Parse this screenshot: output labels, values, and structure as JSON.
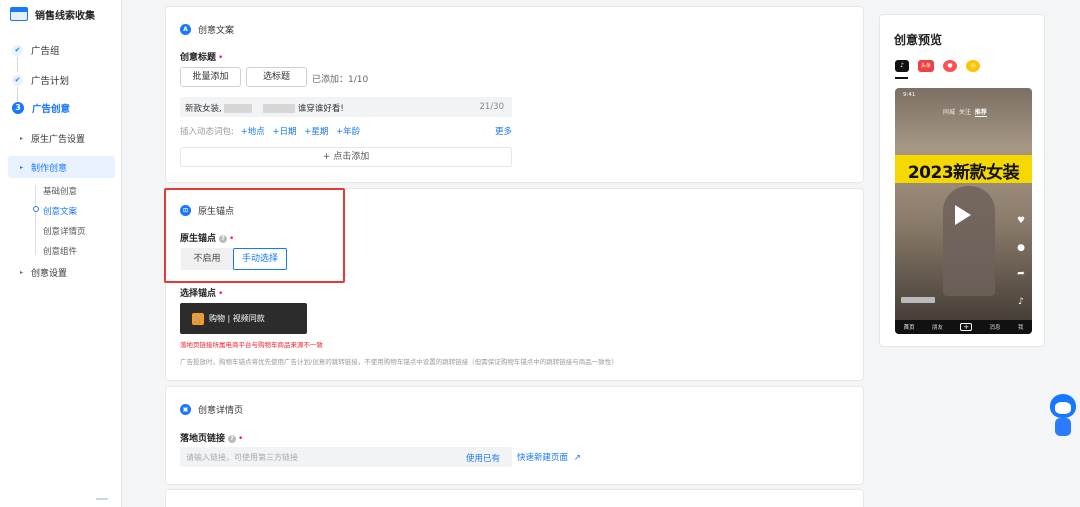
{
  "brand": {
    "title": "销售线索收集"
  },
  "nav": {
    "steps": [
      {
        "label": "广告组",
        "state": "done"
      },
      {
        "label": "广告计划",
        "state": "done"
      },
      {
        "label": "广告创意",
        "state": "active",
        "num": "3"
      }
    ],
    "sub_items": [
      {
        "label": "原生广告设置"
      },
      {
        "label": "制作创意"
      },
      {
        "label": "创意设置"
      }
    ],
    "leaves": [
      "基础创意",
      "创意文案",
      "创意详情页",
      "创意组件"
    ]
  },
  "copy_section": {
    "heading": "创意文案",
    "title_label": "创意标题",
    "batch_add": "批量添加",
    "pick_title": "选标题",
    "added_count": "已添加：1/10",
    "title_prefix": "新款女装,",
    "title_suffix": "谁穿谁好看!",
    "char_count": "21/30",
    "insert_label": "插入动态词包:",
    "words": [
      "+地点",
      "+日期",
      "+星期",
      "+年龄"
    ],
    "more": "更多",
    "click_add": "+ 点击添加"
  },
  "anchor_section": {
    "heading": "原生锚点",
    "anchor_label": "原生锚点",
    "options": [
      "不启用",
      "手动选择"
    ],
    "select_label": "选择锚点",
    "anchor_item": "购物 | 视频同款",
    "warning": "落地页链接所属电商平台与购物车商品来源不一致",
    "note": "广告投放时，购物车锚点将优先使用广告计划/创意的跳转链接，不使用购物车锚点中设置的跳转链接（但需保证购物车锚点中的跳转链接与商品一致性）"
  },
  "detail_section": {
    "heading": "创意详情页",
    "landing_label": "落地页链接",
    "placeholder": "请输入链接，可使用第三方链接",
    "use_existing": "使用已有",
    "quick_create": "快速新建页面"
  },
  "preview": {
    "title": "创意预览",
    "platforms": [
      {
        "name": "tiktok-icon",
        "color": "#111111",
        "glyph": "♪"
      },
      {
        "name": "toutiao-icon",
        "color": "#f04142",
        "glyph": "头条"
      },
      {
        "name": "xigua-icon",
        "color": "#fe4f57",
        "glyph": "●"
      },
      {
        "name": "huoshan-icon",
        "color": "#ffc300",
        "glyph": "◎"
      }
    ],
    "phone": {
      "time": "9:41",
      "tabs": [
        "同城",
        "关注",
        "推荐"
      ],
      "banner": "2023新款女装",
      "bottom": [
        "首页",
        "朋友",
        "+",
        "消息",
        "我"
      ]
    }
  }
}
